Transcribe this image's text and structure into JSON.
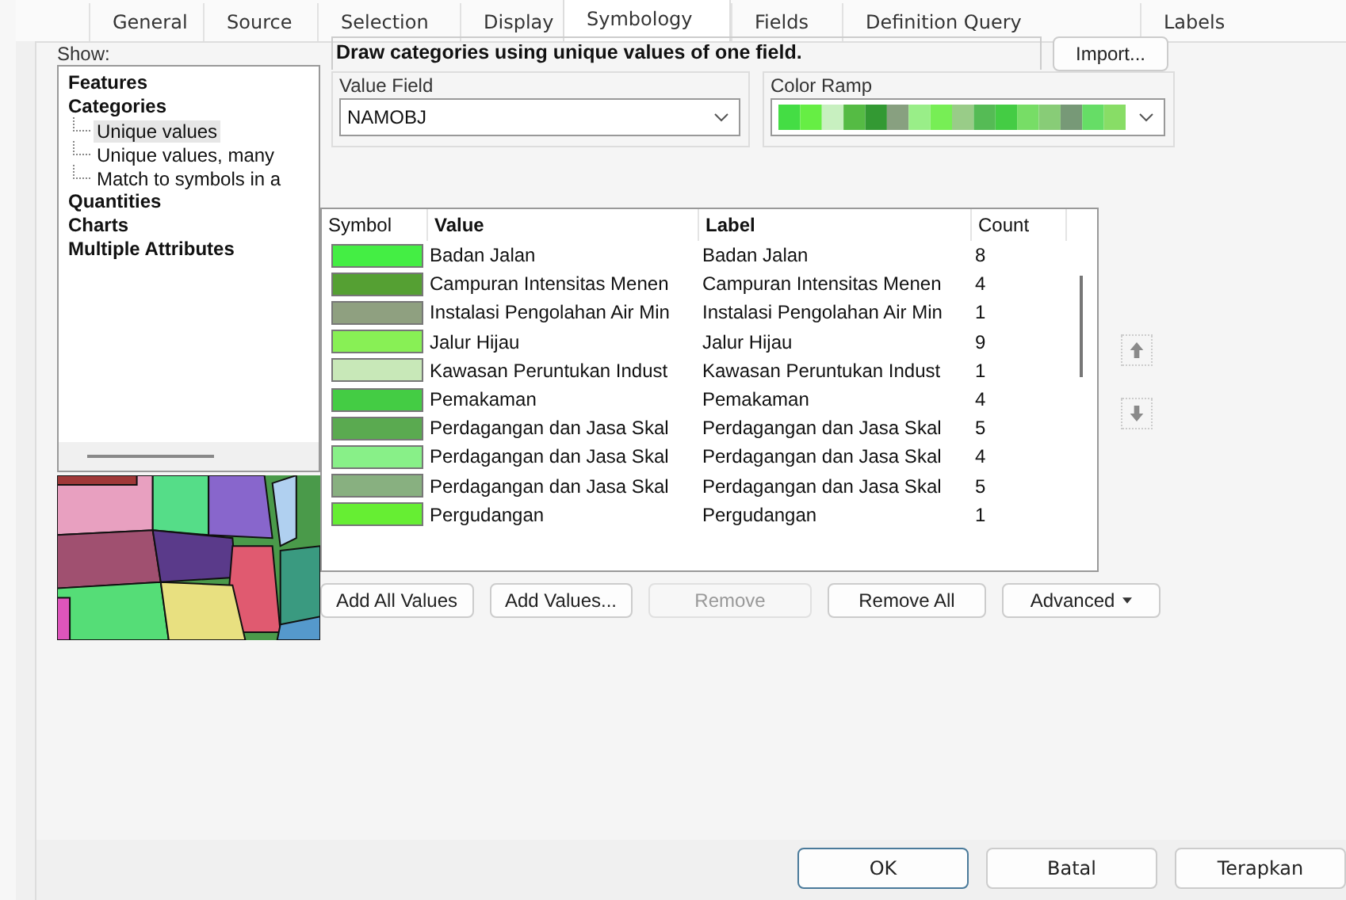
{
  "tabs": [
    {
      "label": "General",
      "selected": false
    },
    {
      "label": "Source",
      "selected": false
    },
    {
      "label": "Selection",
      "selected": false
    },
    {
      "label": "Display",
      "selected": false
    },
    {
      "label": "Symbology",
      "selected": true
    },
    {
      "label": "Fields",
      "selected": false
    },
    {
      "label": "Definition Query",
      "selected": false
    },
    {
      "label": "Labels",
      "selected": false
    }
  ],
  "show": {
    "label": "Show:",
    "tree": [
      {
        "label": "Features",
        "selected": false
      },
      {
        "label": "Categories",
        "selected": false,
        "children": [
          {
            "label": "Unique values",
            "selected": true
          },
          {
            "label": "Unique values, many",
            "selected": false
          },
          {
            "label": "Match to symbols in a",
            "selected": false
          }
        ]
      },
      {
        "label": "Quantities",
        "selected": false
      },
      {
        "label": "Charts",
        "selected": false
      },
      {
        "label": "Multiple Attributes",
        "selected": false
      }
    ]
  },
  "description": "Draw categories using unique values of one field.",
  "import_button": "Import...",
  "value_field": {
    "label": "Value Field",
    "value": "NAMOBJ"
  },
  "color_ramp": {
    "label": "Color Ramp"
  },
  "table": {
    "columns": [
      "Symbol",
      "Value",
      "Label",
      "Count"
    ],
    "rows": [
      {
        "color": "#44ee44",
        "value": "Badan Jalan",
        "label": "Badan Jalan",
        "count": "8"
      },
      {
        "color": "#55a033",
        "value": "Campuran Intensitas Menen",
        "label": "Campuran Intensitas Menen",
        "count": "4"
      },
      {
        "color": "#8fa080",
        "value": "Instalasi Pengolahan Air Min",
        "label": "Instalasi Pengolahan Air Min",
        "count": "1"
      },
      {
        "color": "#88f055",
        "value": "Jalur Hijau",
        "label": "Jalur Hijau",
        "count": "9"
      },
      {
        "color": "#c8e8b8",
        "value": "Kawasan Peruntukan Indust",
        "label": "Kawasan Peruntukan Indust",
        "count": "1"
      },
      {
        "color": "#44cc44",
        "value": "Pemakaman",
        "label": "Pemakaman",
        "count": "4"
      },
      {
        "color": "#5aaa50",
        "value": "Perdagangan dan Jasa Skal",
        "label": "Perdagangan dan Jasa Skal",
        "count": "5"
      },
      {
        "color": "#88f088",
        "value": "Perdagangan dan Jasa Skal",
        "label": "Perdagangan dan Jasa Skal",
        "count": "4"
      },
      {
        "color": "#88b080",
        "value": "Perdagangan dan Jasa Skal",
        "label": "Perdagangan dan Jasa Skal",
        "count": "5"
      },
      {
        "color": "#66ee33",
        "value": "Pergudangan",
        "label": "Pergudangan",
        "count": "1"
      }
    ]
  },
  "table_buttons": [
    {
      "label": "Add All Values",
      "disabled": false
    },
    {
      "label": "Add Values...",
      "disabled": false
    },
    {
      "label": "Remove",
      "disabled": true
    },
    {
      "label": "Remove All",
      "disabled": false
    }
  ],
  "advanced_button": "Advanced",
  "dialog_buttons": [
    "OK",
    "Batal",
    "Terapkan"
  ]
}
